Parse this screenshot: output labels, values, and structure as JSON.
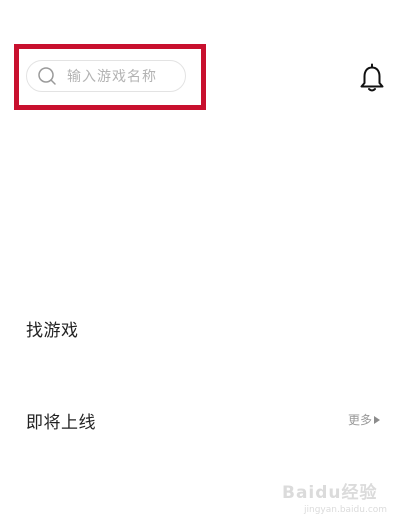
{
  "header": {
    "search": {
      "placeholder": "输入游戏名称"
    },
    "notification_icon": "bell-icon"
  },
  "annotation": {
    "highlight_color": "#c8102e"
  },
  "sections": {
    "find_games": {
      "title": "找游戏"
    },
    "upcoming": {
      "title": "即将上线",
      "more_label": "更多"
    }
  },
  "watermark": {
    "logo": "Baidu经验",
    "url": "jingyan.baidu.com"
  }
}
